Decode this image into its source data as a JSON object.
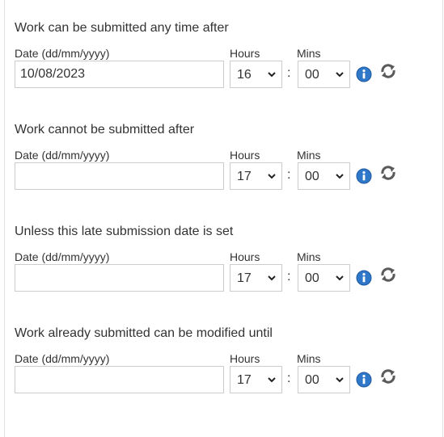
{
  "labels": {
    "date": "Date (dd/mm/yyyy)",
    "hours": "Hours",
    "mins": "Mins",
    "separator": ":"
  },
  "sections": [
    {
      "title": "Work can be submitted any time after",
      "date": "10/08/2023",
      "hours": "16",
      "mins": "00"
    },
    {
      "title": "Work cannot be submitted after",
      "date": "",
      "hours": "17",
      "mins": "00"
    },
    {
      "title": "Unless this late submission date is set",
      "date": "",
      "hours": "17",
      "mins": "00"
    },
    {
      "title": "Work already submitted can be modified until",
      "date": "",
      "hours": "17",
      "mins": "00"
    }
  ],
  "icons": {
    "info": "info-icon",
    "reset": "refresh-icon"
  },
  "colors": {
    "info_blue": "#2f78c9",
    "refresh_gray": "#5a5a5a",
    "border": "#cccccc",
    "text": "#333333"
  }
}
